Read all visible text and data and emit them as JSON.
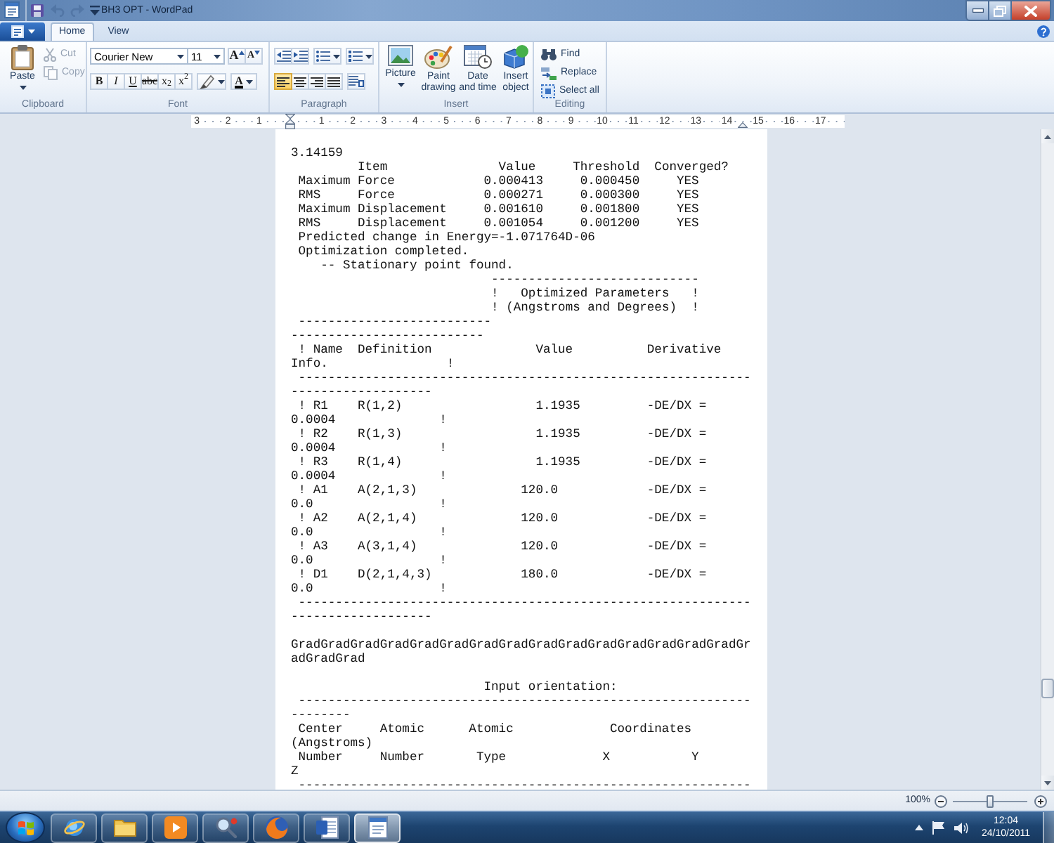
{
  "title_bar": {
    "quick_access": [
      {
        "kind": "save",
        "disabled": false
      },
      {
        "kind": "undo",
        "disabled": true
      },
      {
        "kind": "redo",
        "disabled": true
      },
      {
        "kind": "customize",
        "disabled": false
      }
    ],
    "title": "BH3 OPT - WordPad"
  },
  "ribbon_tabs": [
    {
      "label": "Home",
      "selected": true
    },
    {
      "label": "View",
      "selected": false
    }
  ],
  "clipboard": {
    "label": "Clipboard",
    "paste": {
      "label": "Paste"
    },
    "commands": [
      {
        "kind": "cut",
        "label": "Cut",
        "disabled": true
      },
      {
        "kind": "copy",
        "label": "Copy",
        "disabled": true
      }
    ]
  },
  "font": {
    "label": "Font",
    "font_name": "Courier New",
    "font_size": "11",
    "size_buttons": [
      {
        "kind": "grow",
        "glyph": "A"
      },
      {
        "kind": "shrink",
        "glyph": "A"
      }
    ],
    "format_buttons": [
      {
        "kind": "bold",
        "glyph": "B"
      },
      {
        "kind": "italic",
        "glyph": "I"
      },
      {
        "kind": "underline",
        "glyph": "U"
      },
      {
        "kind": "strikethrough",
        "glyph": "abc"
      },
      {
        "kind": "subscript",
        "glyph": "x$_{2}$"
      },
      {
        "kind": "superscript",
        "glyph": "x$^{2}$"
      }
    ],
    "color_buttons": [
      {
        "kind": "highlight"
      },
      {
        "kind": "color",
        "glyph": "A"
      }
    ]
  },
  "paragraph": {
    "label": "Paragraph",
    "indent_buttons": [
      {
        "kind": "decrease"
      },
      {
        "kind": "increase"
      }
    ],
    "list_buttons": [
      {
        "kind": "bullets"
      },
      {
        "kind": "numbering"
      }
    ],
    "align_buttons": [
      {
        "kind": "left",
        "selected": true
      },
      {
        "kind": "center",
        "selected": false
      },
      {
        "kind": "right",
        "selected": false
      },
      {
        "kind": "justify",
        "selected": false
      }
    ]
  },
  "insert": {
    "label": "Insert",
    "commands": [
      {
        "kind": "picture",
        "label": "Picture",
        "menu": true
      },
      {
        "kind": "paint",
        "label": "Paint drawing",
        "menu": false
      },
      {
        "kind": "datetime",
        "label": "Date and time",
        "menu": false
      },
      {
        "kind": "object",
        "label": "Insert object",
        "menu": false
      }
    ]
  },
  "editing": {
    "label": "Editing",
    "commands": [
      {
        "kind": "find",
        "label": "Find"
      },
      {
        "kind": "replace",
        "label": "Replace"
      },
      {
        "kind": "select",
        "label": "Select all"
      }
    ]
  },
  "ruler": {
    "left_numbers": [
      "3",
      "2",
      "1"
    ],
    "right_numbers": [
      "1",
      "2",
      "3",
      "4",
      "5",
      "6",
      "7",
      "8",
      "9",
      "10",
      "11",
      "12",
      "13",
      "14",
      "15",
      "16",
      "17"
    ]
  },
  "document": {
    "blocks": [
      {
        "lines": [
          "3.14159",
          "         Item               Value     Threshold  Converged?",
          " Maximum Force            0.000413     0.000450     YES",
          " RMS     Force            0.000271     0.000300     YES",
          " Maximum Displacement     0.001610     0.001800     YES",
          " RMS     Displacement     0.001054     0.001200     YES",
          " Predicted change in Energy=-1.071764D-06",
          " Optimization completed.",
          "    -- Stationary point found.",
          "                           ----------------------------",
          "                           !   Optimized Parameters   !",
          "                           ! (Angstroms and Degrees)  !",
          " --------------------------",
          "--------------------------",
          " ! Name  Definition              Value          Derivative",
          "Info.                !",
          " -------------------------------------------------------------",
          "-------------------",
          " ! R1    R(1,2)                  1.1935         -DE/DX =",
          "0.0004              !",
          " ! R2    R(1,3)                  1.1935         -DE/DX =",
          "0.0004              !",
          " ! R3    R(1,4)                  1.1935         -DE/DX =",
          "0.0004              !",
          " ! A1    A(2,1,3)              120.0            -DE/DX =",
          "0.0                 !",
          " ! A2    A(2,1,4)              120.0            -DE/DX =",
          "0.0                 !",
          " ! A3    A(3,1,4)              120.0            -DE/DX =",
          "0.0                 !",
          " ! D1    D(2,1,4,3)            180.0            -DE/DX =",
          "0.0                 !",
          " -------------------------------------------------------------",
          "-------------------"
        ]
      },
      {
        "lines": [
          "GradGradGradGradGradGradGradGradGradGradGradGradGradGradGradGr",
          "adGradGrad"
        ]
      },
      {
        "lines": [
          "                          Input orientation:",
          " -------------------------------------------------------------",
          "--------",
          " Center     Atomic      Atomic             Coordinates",
          "(Angstroms)",
          " Number     Number       Type             X           Y",
          "Z",
          " -------------------------------------------------------------"
        ]
      }
    ]
  },
  "status_bar": {
    "zoom": "100%",
    "zoom_slider": {
      "level": 0.5
    }
  },
  "taskbar": {
    "apps": [
      {
        "kind": "browser",
        "selected": false
      },
      {
        "kind": "folder",
        "selected": false
      },
      {
        "kind": "media",
        "selected": false
      },
      {
        "kind": "magnifier",
        "selected": false
      },
      {
        "kind": "fox",
        "selected": false
      },
      {
        "kind": "word",
        "selected": false
      },
      {
        "kind": "wordpad",
        "selected": true
      }
    ],
    "clock": {
      "time": "12:04",
      "date": "24/10/2011"
    }
  }
}
